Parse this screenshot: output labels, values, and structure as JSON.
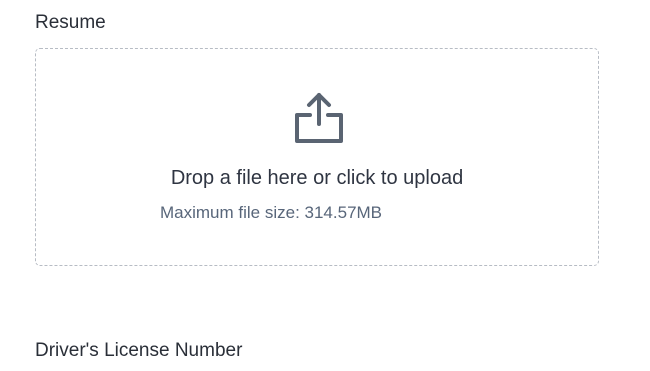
{
  "resume": {
    "label": "Resume",
    "dropzone": {
      "icon": "upload-icon",
      "prompt": "Drop a file here or click to upload",
      "max_size": "Maximum file size: 314.57MB"
    }
  },
  "drivers_license": {
    "label": "Driver's License Number"
  },
  "colors": {
    "icon": "#5a6472",
    "border": "#b7bcc4",
    "text": "#2f3542",
    "muted": "#58667a"
  }
}
